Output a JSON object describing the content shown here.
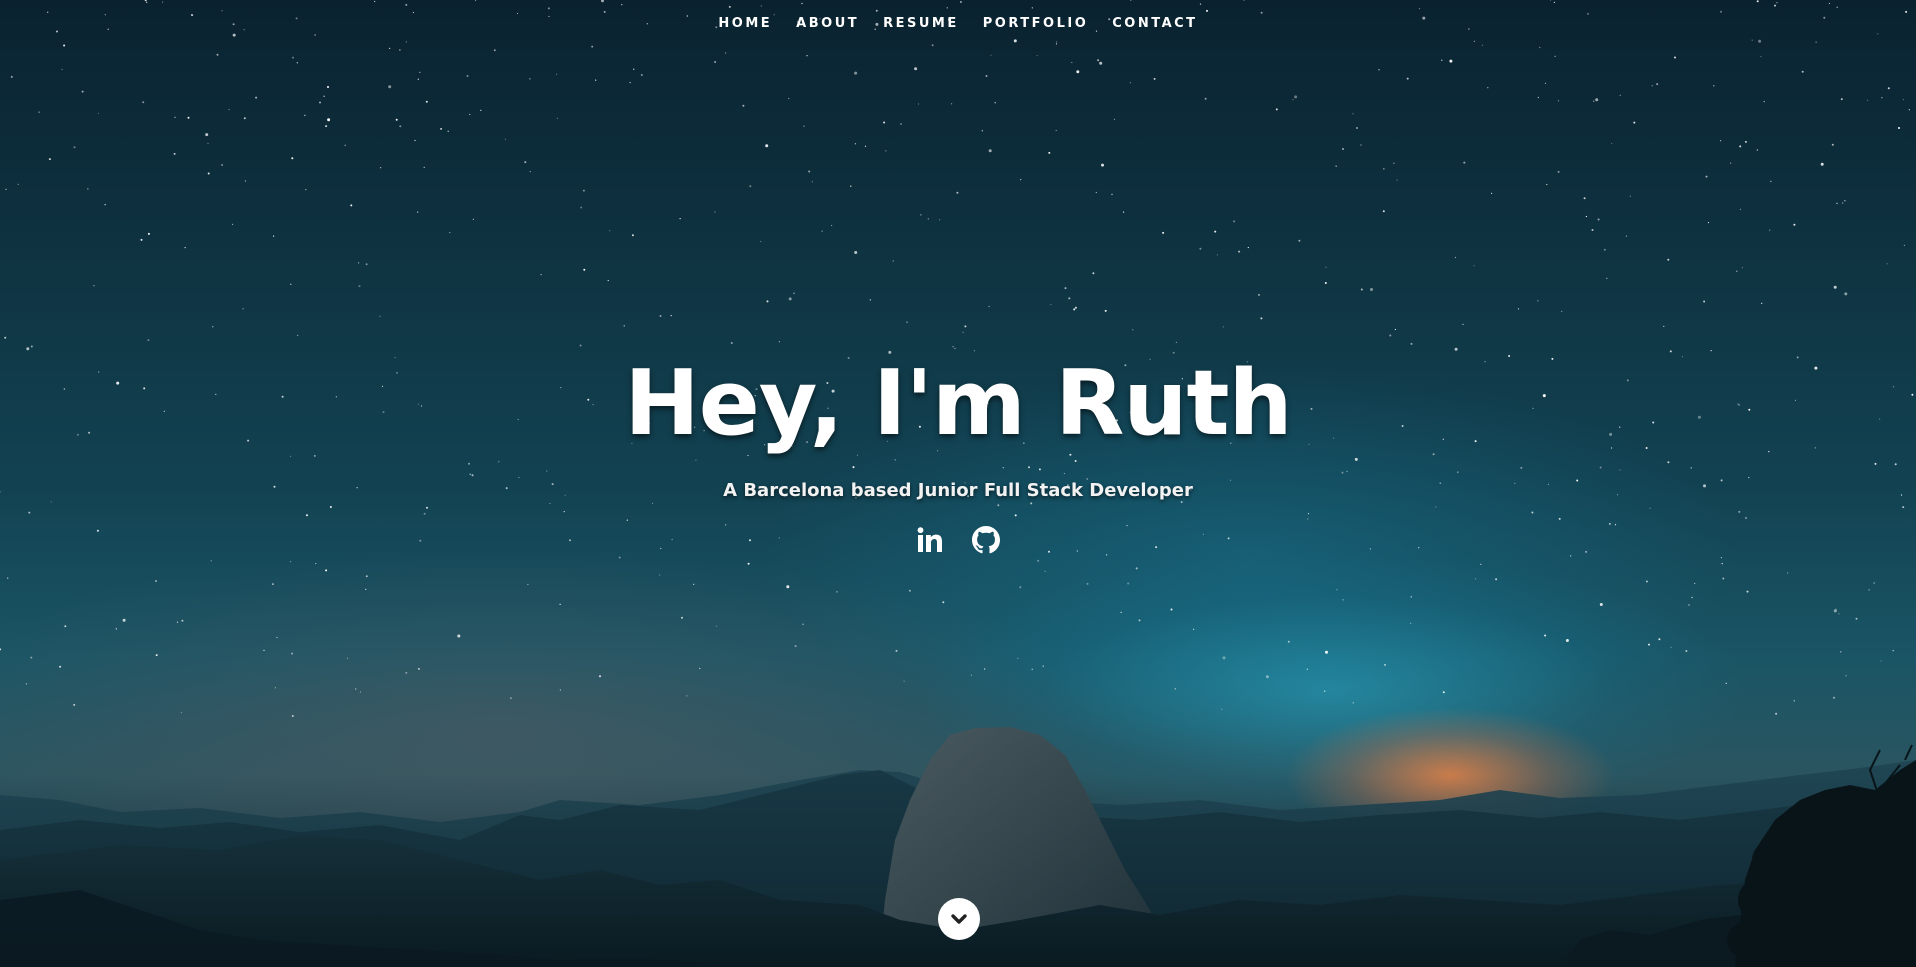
{
  "nav": {
    "items": [
      {
        "label": "HOME"
      },
      {
        "label": "ABOUT"
      },
      {
        "label": "RESUME"
      },
      {
        "label": "PORTFOLIO"
      },
      {
        "label": "CONTACT"
      }
    ]
  },
  "banner": {
    "headline": "Hey, I'm Ruth",
    "subtitle": "A Barcelona based Junior Full Stack Developer",
    "social": [
      {
        "icon": "linkedin-icon"
      },
      {
        "icon": "github-icon"
      }
    ]
  },
  "scroll_button": {
    "icon": "chevron-down-icon"
  },
  "colors": {
    "text": "#ffffff",
    "sky_top": "#0a2230",
    "sky_glow": "#28aac8",
    "horizon_glow": "#e68246"
  }
}
